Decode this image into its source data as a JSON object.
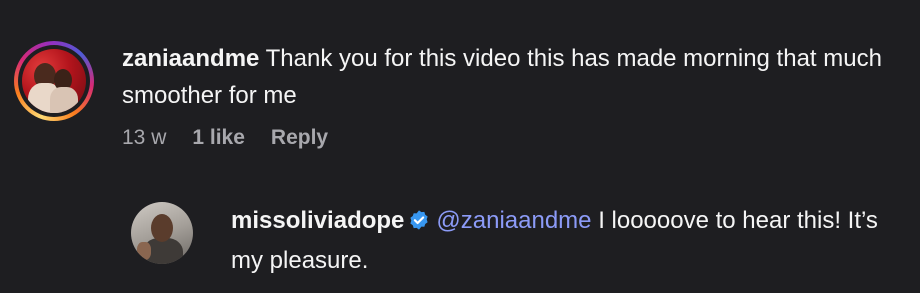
{
  "comment": {
    "username": "zaniaandme",
    "text": "Thank you for this video this has made morning that much smoother for me",
    "time": "13 w",
    "likes": "1 like",
    "reply_label": "Reply"
  },
  "reply": {
    "username": "missoliviadope",
    "verified": true,
    "mention": "@zaniaandme",
    "text": "I looooove to hear this! It’s my pleasure."
  },
  "colors": {
    "background": "#1e1e21",
    "text": "#f5f5f5",
    "muted": "#a8a8ad",
    "mention": "#8c9bf7",
    "verified": "#3897f0"
  }
}
